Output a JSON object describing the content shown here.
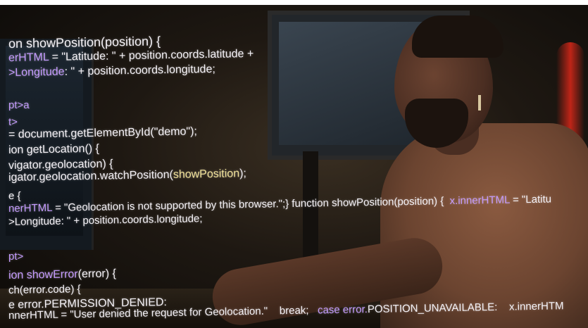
{
  "scene": {
    "description_icon": "developer-at-computer-photo",
    "accent_colors": {
      "code_text": "#f4f1f6",
      "code_keyword": "#c59bff",
      "code_highlight": "#f3e39a",
      "red_glow": "#dc2819"
    }
  },
  "code_lines": [
    {
      "segments": [
        {
          "text": "on showPosition(position) {",
          "color": "white"
        }
      ]
    },
    {
      "segments": [
        {
          "text": "erHTML",
          "color": "purple"
        },
        {
          "text": " = \"Latitude: \" + position.coords.latitude +",
          "color": "white"
        }
      ]
    },
    {
      "segments": [
        {
          "text": ">Longitude",
          "color": "purple"
        },
        {
          "text": ": \" + position.coords.longitude;",
          "color": "white"
        }
      ]
    },
    {
      "segments": [
        {
          "text": "pt>a",
          "color": "purple"
        }
      ]
    },
    {
      "segments": [
        {
          "text": "t>",
          "color": "purple"
        }
      ]
    },
    {
      "segments": [
        {
          "text": "= document.getElementById(\"demo\");",
          "color": "white"
        }
      ]
    },
    {
      "segments": [
        {
          "text": "ion getLocation() {",
          "color": "white"
        }
      ]
    },
    {
      "segments": [
        {
          "text": "vigator.geolocation) {",
          "color": "white"
        }
      ]
    },
    {
      "segments": [
        {
          "text": "igator.geolocation.watchPosition(",
          "color": "white"
        },
        {
          "text": "showPosition",
          "color": "yellow"
        },
        {
          "text": ");",
          "color": "white"
        }
      ]
    },
    {
      "segments": [
        {
          "text": "e {",
          "color": "white"
        }
      ]
    },
    {
      "segments": [
        {
          "text": "nerHTML",
          "color": "purple"
        },
        {
          "text": " = \"Geolocation is not supported by this browser.\";} function showPosition(position) {  ",
          "color": "white"
        },
        {
          "text": "x.innerHTML",
          "color": "purple"
        },
        {
          "text": " = \"Latitu",
          "color": "white"
        }
      ]
    },
    {
      "segments": [
        {
          "text": ">Longitude",
          "color": "white"
        },
        {
          "text": ": \" + position.coords.longitude;",
          "color": "white"
        }
      ]
    },
    {
      "segments": [
        {
          "text": "pt>",
          "color": "purple"
        }
      ]
    },
    {
      "segments": [
        {
          "text": "ion showError",
          "color": "purple"
        },
        {
          "text": "(error) {",
          "color": "white"
        }
      ]
    },
    {
      "segments": [
        {
          "text": "ch(error.code) {",
          "color": "white"
        }
      ]
    },
    {
      "segments": [
        {
          "text": "e error.PERMISSION_DENIED:",
          "color": "white"
        }
      ]
    },
    {
      "segments": [
        {
          "text": "nnerHTML = \"User denied the request for Geolocation.\"    break;   ",
          "color": "white"
        },
        {
          "text": "case error.",
          "color": "purple"
        },
        {
          "text": "POSITION_UNAVAILABLE:    x.innerHTM",
          "color": "white"
        }
      ]
    }
  ]
}
